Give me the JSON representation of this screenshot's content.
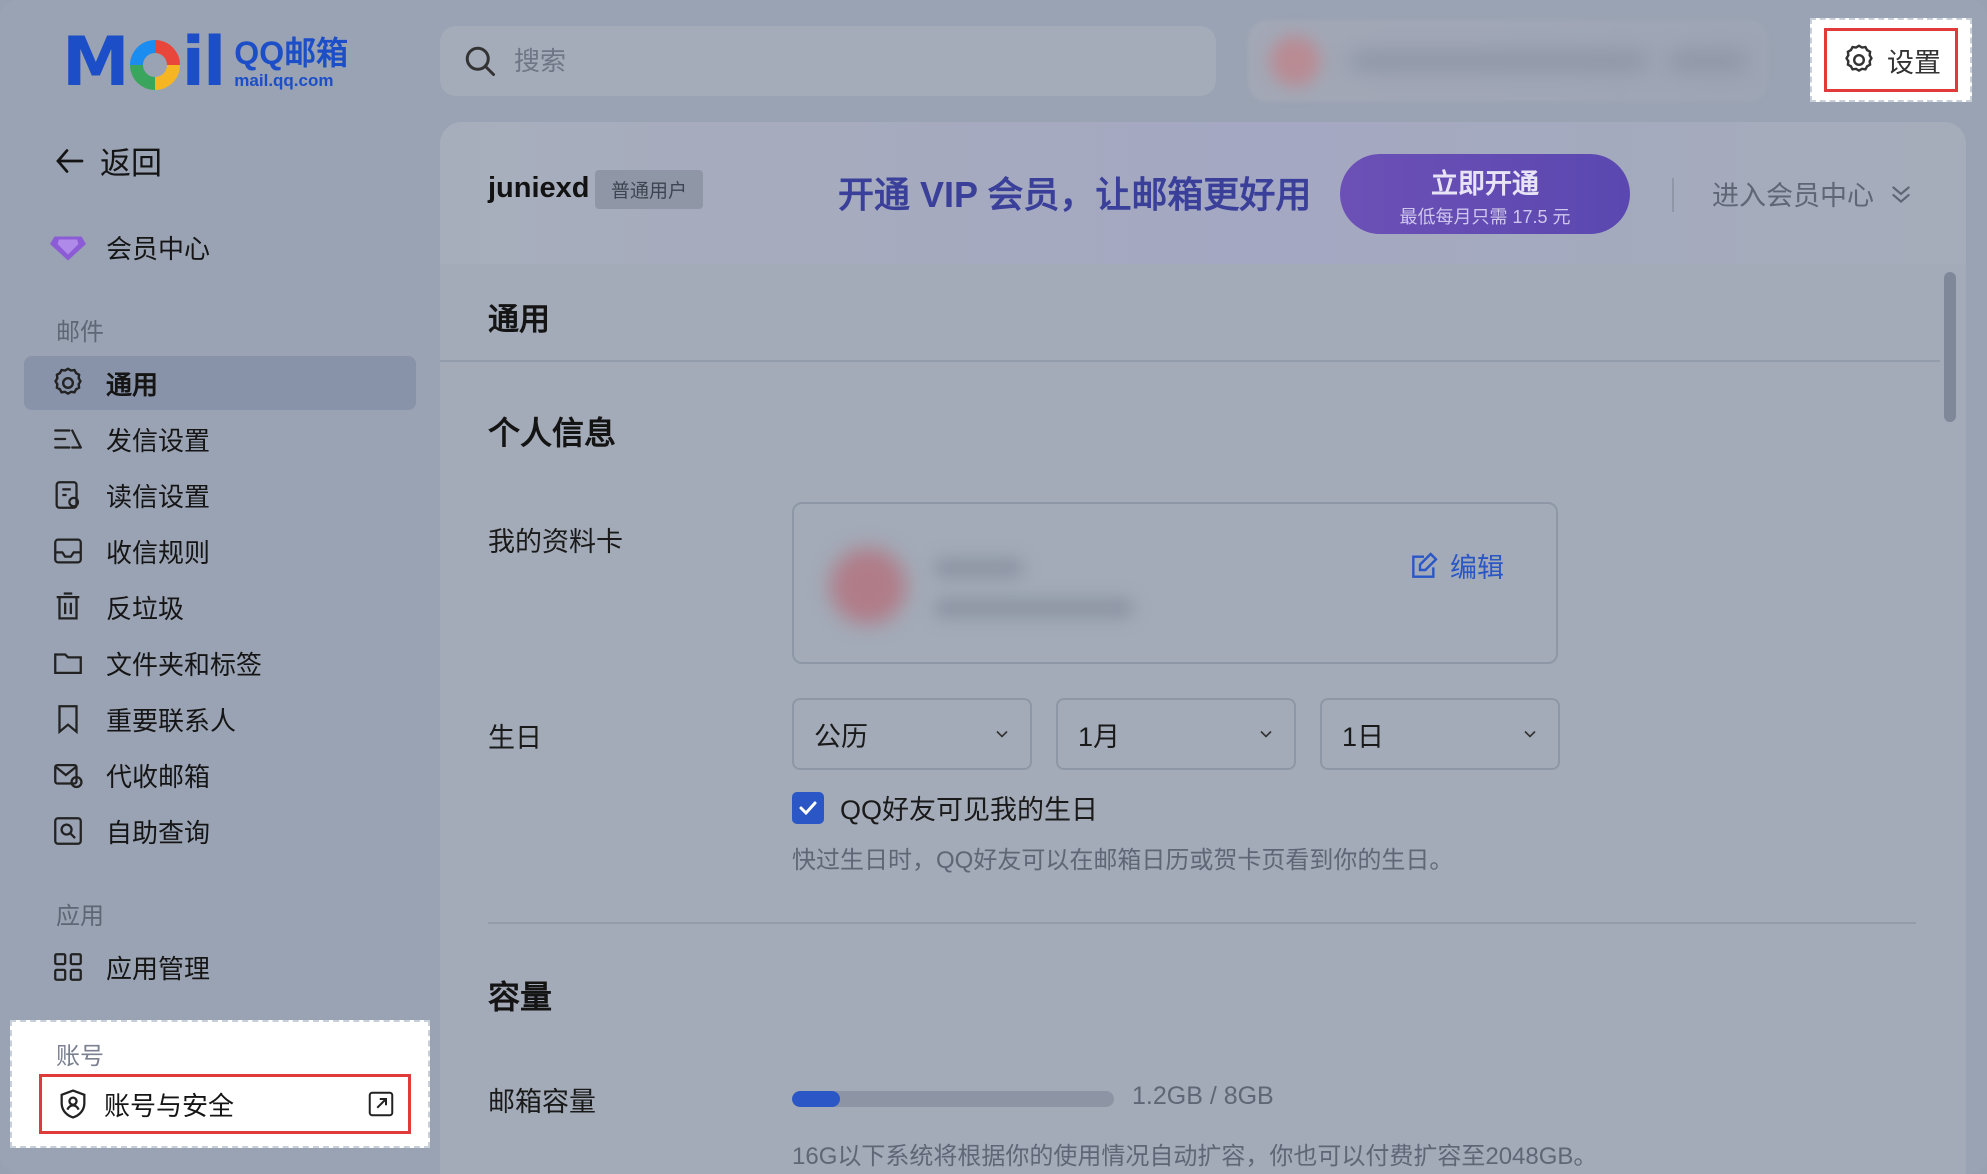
{
  "logo": {
    "word_m": "M",
    "word_il": "il",
    "brand": "QQ邮箱",
    "domain": "mail.qq.com"
  },
  "search": {
    "placeholder": "搜索"
  },
  "header": {
    "settings_label": "设置"
  },
  "sidebar": {
    "back_label": "返回",
    "vip_label": "会员中心",
    "mail_section": "邮件",
    "mail_items": [
      {
        "label": "通用",
        "icon": "gear-icon",
        "active": true
      },
      {
        "label": "发信设置",
        "icon": "send-settings-icon"
      },
      {
        "label": "读信设置",
        "icon": "read-settings-icon"
      },
      {
        "label": "收信规则",
        "icon": "inbox-rule-icon"
      },
      {
        "label": "反垃圾",
        "icon": "trash-icon"
      },
      {
        "label": "文件夹和标签",
        "icon": "folder-icon"
      },
      {
        "label": "重要联系人",
        "icon": "bookmark-icon"
      },
      {
        "label": "代收邮箱",
        "icon": "mail-collect-icon"
      },
      {
        "label": "自助查询",
        "icon": "self-query-icon"
      }
    ],
    "app_section": "应用",
    "app_items": [
      {
        "label": "应用管理",
        "icon": "grid-icon"
      }
    ],
    "account_section": "账号",
    "account_item": {
      "label": "账号与安全",
      "icon": "shield-icon"
    }
  },
  "vip": {
    "username": "juniexd",
    "badge": "普通用户",
    "slogan": "开通 VIP 会员，让邮箱更好用",
    "button_title": "立即开通",
    "button_sub": "最低每月只需 17.5 元",
    "center_link": "进入会员中心"
  },
  "main": {
    "tab_title": "通用",
    "personal_section": "个人信息",
    "profile_label": "我的资料卡",
    "edit_label": "编辑",
    "birthday_label": "生日",
    "birthday_calendar": "公历",
    "birthday_month": "1月",
    "birthday_day": "1日",
    "birthday_visible_label": "QQ好友可见我的生日",
    "birthday_visible_checked": true,
    "birthday_hint": "快过生日时，QQ好友可以在邮箱日历或贺卡页看到你的生日。",
    "capacity_section": "容量",
    "mailbox_capacity_label": "邮箱容量",
    "capacity_value": "1.2GB / 8GB",
    "capacity_used_fraction": 0.15,
    "capacity_hint": "16G以下系统将根据你的使用情况自动扩容，你也可以付费扩容至2048GB。"
  },
  "colors": {
    "accent": "#2a56c6",
    "highlight": "#e03a3a",
    "vip": "#5a48b0"
  }
}
